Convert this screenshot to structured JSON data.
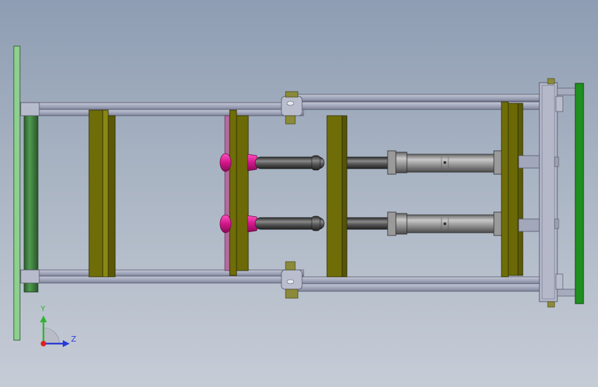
{
  "viewport": {
    "background_top": "#8e9db3",
    "background_bottom": "#c6ccd6"
  },
  "triad": {
    "y_label": "Y",
    "z_label": "Z",
    "y_color": "#2fb52f",
    "z_color": "#2a3ad6",
    "origin_color": "#e02020"
  },
  "colors": {
    "frame_rail": "#a8adc2",
    "olive_plate": "#6f6d08",
    "green_roller": "#3a7a3a",
    "pale_green_plate": "#8ed08e",
    "bright_green_plate": "#1f8f1f",
    "magenta_part": "#d6188a",
    "rod": "#4f4f4f",
    "cylinder": "#8c8c8c"
  }
}
